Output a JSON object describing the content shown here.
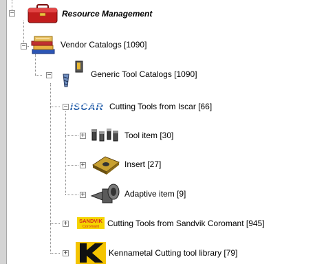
{
  "tree": {
    "root": {
      "label": "Resource Management",
      "expander": "−",
      "icon": "toolbox-icon"
    },
    "vendor_catalogs": {
      "label": "Vendor Catalogs  [1090]",
      "expander": "−",
      "icon": "book-stack-icon"
    },
    "generic_catalogs": {
      "label": "Generic Tool Catalogs  [1090]",
      "expander": "−",
      "icon": "drill-bit-icon"
    },
    "iscar": {
      "label": "Cutting Tools from Iscar  [66]",
      "expander": "−",
      "logo_text": "ISCAR",
      "icon": "iscar-logo-icon"
    },
    "iscar_children": [
      {
        "label": "Tool item  [30]",
        "expander": "+",
        "icon": "tool-item-icon"
      },
      {
        "label": "Insert  [27]",
        "expander": "+",
        "icon": "insert-icon"
      },
      {
        "label": "Adaptive item  [9]",
        "expander": "+",
        "icon": "adaptive-item-icon"
      }
    ],
    "sandvik": {
      "label": "Cutting Tools from Sandvik Coromant  [945]",
      "expander": "+",
      "logo_text": "SANDVIK",
      "logo_sub": "Coromant",
      "icon": "sandvik-logo-icon"
    },
    "kennametal": {
      "label": "Kennametal Cutting tool library  [79]",
      "expander": "+",
      "icon": "kennametal-logo-icon"
    }
  },
  "colors": {
    "sandvik_yellow": "#f5d400",
    "sandvik_red": "#d52b1e",
    "kennametal_yellow": "#f4c400",
    "iscar_blue": "#1e5aa8"
  }
}
